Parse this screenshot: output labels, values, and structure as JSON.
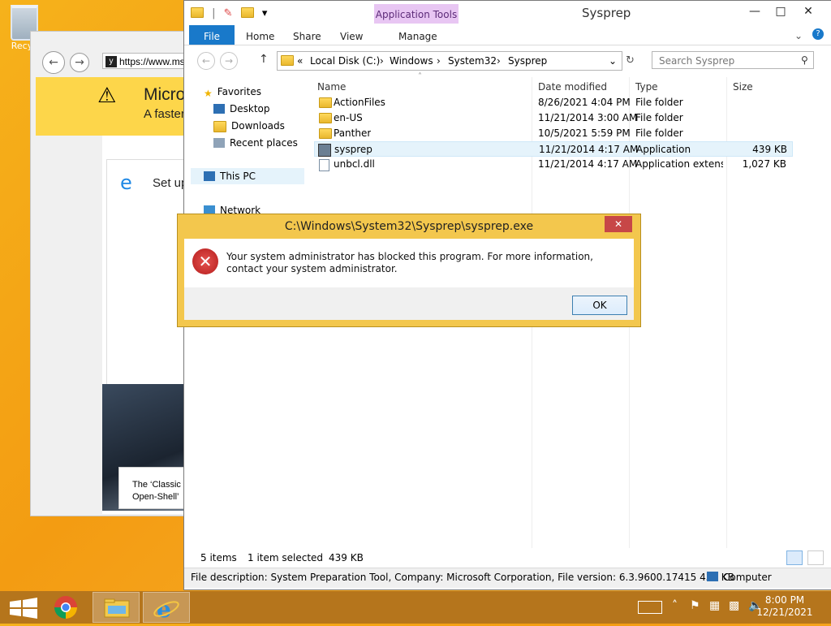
{
  "desktop": {
    "recycle_label": "Recyc"
  },
  "browser": {
    "url": "https://www.ms",
    "banner_title": "Micro",
    "banner_subtitle": "A faster",
    "setup_text": "Set up",
    "caption": "The ‘Classic\nOpen-Shell’"
  },
  "explorer": {
    "title": "Sysprep",
    "app_tools": "Application Tools",
    "tabs": {
      "file": "File",
      "home": "Home",
      "share": "Share",
      "view": "View",
      "manage": "Manage"
    },
    "breadcrumb": {
      "prefix": "«",
      "items": [
        "Local Disk (C:)",
        "Windows",
        "System32",
        "Sysprep"
      ]
    },
    "search_placeholder": "Search Sysprep",
    "nav": {
      "favorites": "Favorites",
      "desktop": "Desktop",
      "downloads": "Downloads",
      "recent": "Recent places",
      "thispc": "This PC",
      "network": "Network"
    },
    "columns": {
      "name": "Name",
      "date": "Date modified",
      "type": "Type",
      "size": "Size"
    },
    "files": [
      {
        "name": "ActionFiles",
        "date": "8/26/2021 4:04 PM",
        "type": "File folder",
        "size": ""
      },
      {
        "name": "en-US",
        "date": "11/21/2014 3:00 AM",
        "type": "File folder",
        "size": ""
      },
      {
        "name": "Panther",
        "date": "10/5/2021 5:59 PM",
        "type": "File folder",
        "size": ""
      },
      {
        "name": "sysprep",
        "date": "11/21/2014 4:17 AM",
        "type": "Application",
        "size": "439 KB"
      },
      {
        "name": "unbcl.dll",
        "date": "11/21/2014 4:17 AM",
        "type": "Application extens...",
        "size": "1,027 KB"
      }
    ],
    "status": {
      "items": "5 items",
      "selected": "1 item selected",
      "selected_size": "439 KB"
    },
    "description": "File description: System Preparation Tool, Company: Microsoft Corporation, File version: 6.3.9600.17415 439 KB",
    "computer": "Computer"
  },
  "dialog": {
    "title": "C:\\Windows\\System32\\Sysprep\\sysprep.exe",
    "message": "Your system administrator has blocked this program. For more information, contact your system administrator.",
    "ok": "OK",
    "close": "✕"
  },
  "taskbar": {
    "time": "8:00 PM",
    "date": "12/21/2021"
  },
  "icons": {
    "start": "windows-logo",
    "chrome": "chrome",
    "explorer": "file-explorer",
    "ie": "internet-explorer",
    "error": "error-x"
  },
  "colors": {
    "accent": "#1979ca",
    "app_tools": "#e8c6f3",
    "dialog_frame": "#f3c74d",
    "taskbar": "#b5751c"
  }
}
